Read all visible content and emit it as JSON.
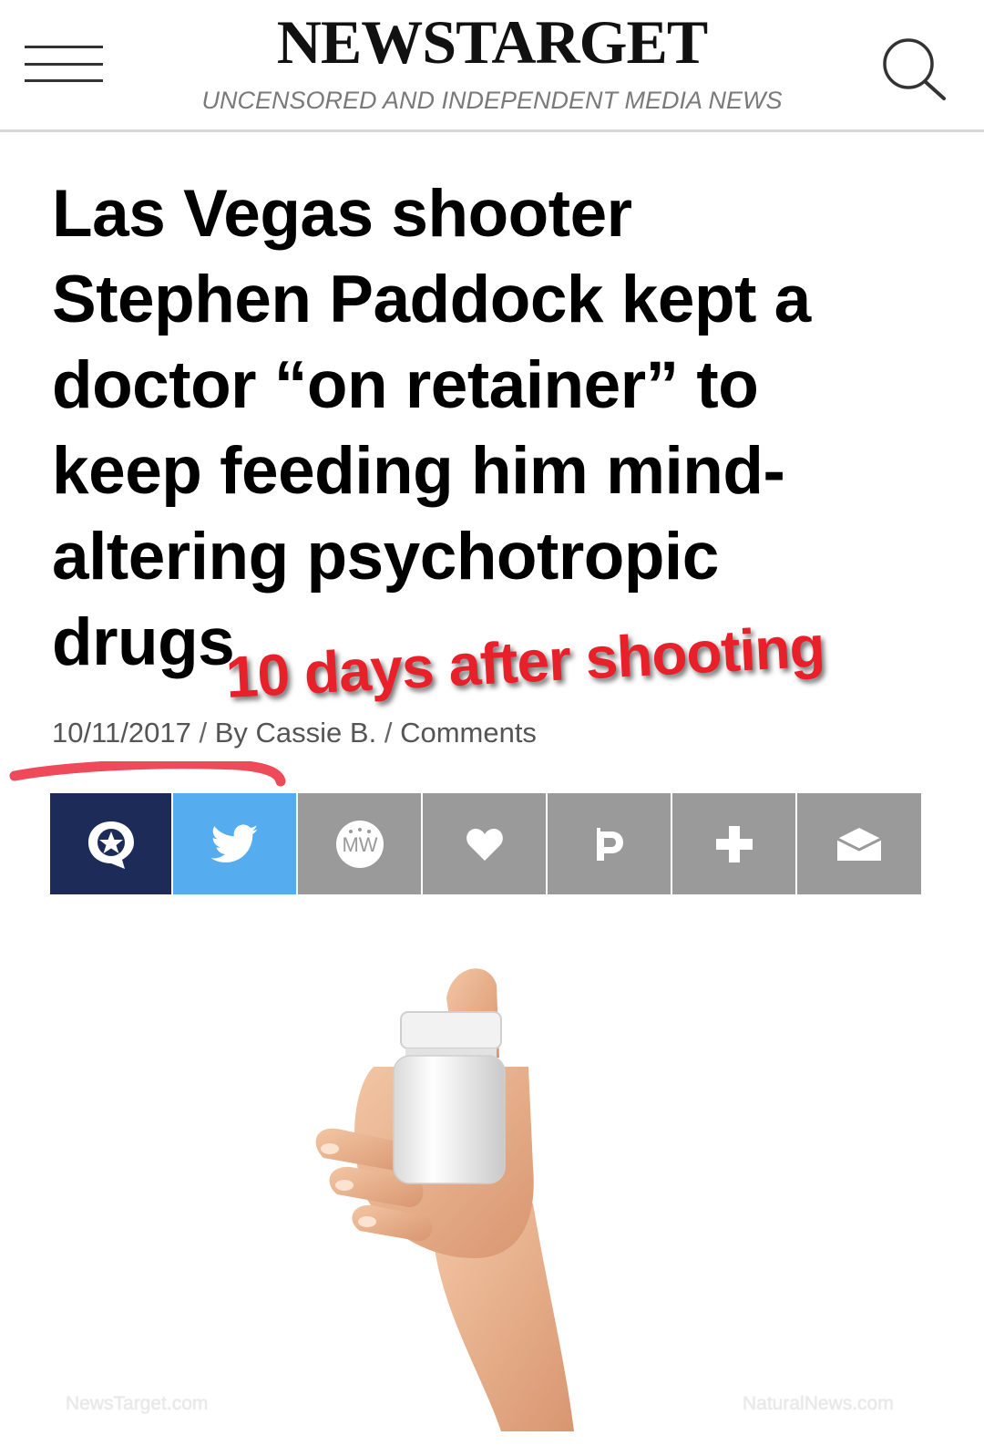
{
  "header": {
    "logo": "NEWSTARGET",
    "tagline": "UNCENSORED AND INDEPENDENT MEDIA NEWS",
    "menu_icon": "hamburger-menu-icon",
    "search_icon": "search-icon"
  },
  "article": {
    "headline": "Las Vegas shooter Stephen Paddock kept a doctor “on retainer” to keep feeding him mind-altering psychotropic drugs",
    "overlay_annotation": "10 days after shooting",
    "date": "10/11/2017",
    "separator": "/",
    "byline": "By Cassie B.",
    "comments_label": "Comments"
  },
  "share_bar": [
    {
      "name": "share-chat",
      "icon": "speech-bubble-star-icon",
      "color": "#1c2b57"
    },
    {
      "name": "share-twitter",
      "icon": "twitter-bird-icon",
      "color": "#55acee"
    },
    {
      "name": "share-mewe",
      "icon": "mewe-icon",
      "color": "#9a9a9a"
    },
    {
      "name": "share-favorite",
      "icon": "heart-icon",
      "color": "#9a9a9a"
    },
    {
      "name": "share-parler",
      "icon": "parler-icon",
      "color": "#9a9a9a"
    },
    {
      "name": "share-more",
      "icon": "plus-icon",
      "color": "#9a9a9a"
    },
    {
      "name": "share-email",
      "icon": "envelope-icon",
      "color": "#9a9a9a"
    }
  ],
  "image": {
    "subject": "hand-holding-pill-bottle",
    "watermark_left": "NewsTarget.com",
    "watermark_right": "NaturalNews.com"
  },
  "colors": {
    "annotation_red": "#e8202a",
    "underline_red": "#ee4a5a",
    "share_gray": "#9a9a9a",
    "share_navy": "#1c2b57",
    "share_twitter": "#55acee"
  }
}
